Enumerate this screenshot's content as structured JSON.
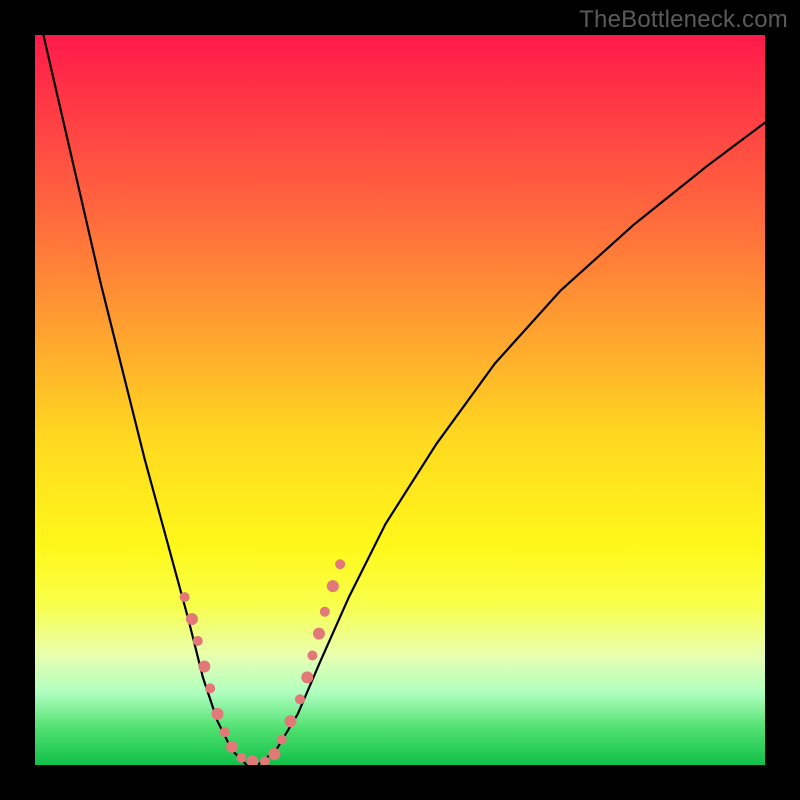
{
  "watermark": "TheBottleneck.com",
  "chart_data": {
    "type": "line",
    "title": "",
    "xlabel": "",
    "ylabel": "",
    "xlim": [
      0,
      100
    ],
    "ylim": [
      0,
      100
    ],
    "series": [
      {
        "name": "bottleneck-curve",
        "x": [
          0,
          3,
          6,
          9,
          12,
          15,
          18,
          21,
          23,
          25,
          27,
          29,
          30.5,
          33,
          36,
          39,
          43,
          48,
          55,
          63,
          72,
          82,
          92,
          100
        ],
        "y": [
          105,
          92,
          79,
          66,
          54,
          42,
          31,
          20,
          12,
          6,
          2,
          0,
          0,
          2,
          7,
          14,
          23,
          33,
          44,
          55,
          65,
          74,
          82,
          88
        ]
      }
    ],
    "markers": {
      "name": "highlight-dots",
      "color": "#e27878",
      "radius_pattern": [
        5,
        6,
        5,
        6,
        5,
        6,
        5,
        6
      ],
      "x": [
        20.5,
        21.5,
        22.3,
        23.2,
        24.0,
        25.0,
        26.0,
        27.0,
        28.3,
        29.8,
        31.5,
        32.8,
        33.8,
        35.0,
        36.3,
        37.3,
        38.0,
        38.9,
        39.7,
        40.8,
        41.8
      ],
      "y": [
        23,
        20,
        17,
        13.5,
        10.5,
        7,
        4.5,
        2.5,
        1,
        0.5,
        0.5,
        1.5,
        3.5,
        6,
        9,
        12,
        15,
        18,
        21,
        24.5,
        27.5
      ]
    }
  }
}
